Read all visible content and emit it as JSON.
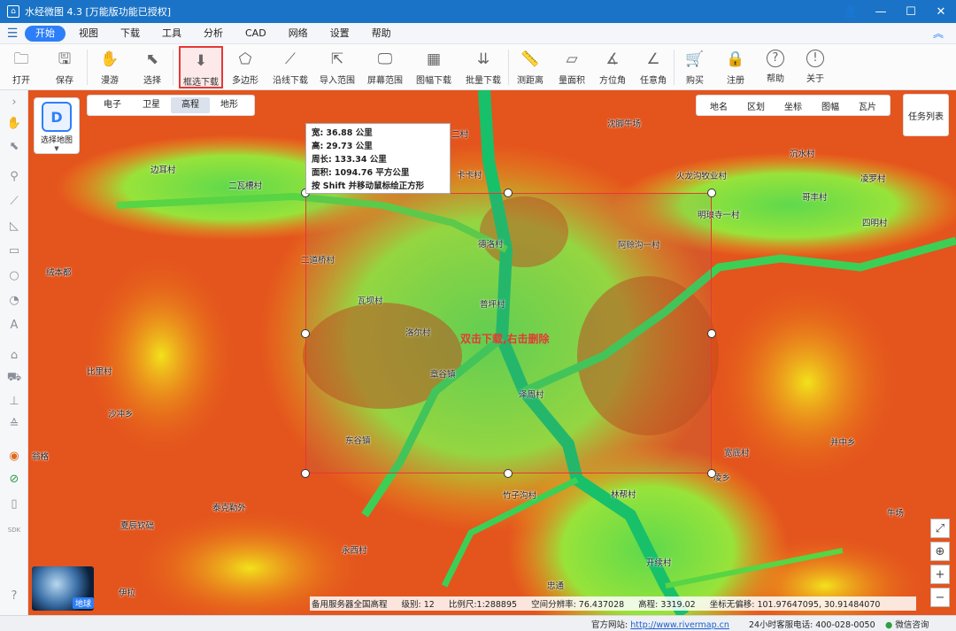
{
  "window": {
    "title": "水经微图 4.3 [万能版功能已授权]",
    "controls": [
      "👤",
      "—",
      "☐",
      "✕"
    ]
  },
  "menu": {
    "items": [
      "开始",
      "视图",
      "下载",
      "工具",
      "分析",
      "CAD",
      "网络",
      "设置",
      "帮助"
    ],
    "active": "开始"
  },
  "toolbar": {
    "tools": [
      {
        "label": "打开",
        "icon": "folder-icon",
        "glyph": "🗀"
      },
      {
        "label": "保存",
        "icon": "save-icon",
        "glyph": "🖫"
      },
      {
        "label": "漫游",
        "icon": "hand-icon",
        "glyph": "✋"
      },
      {
        "label": "选择",
        "icon": "cursor-icon",
        "glyph": "⬉"
      },
      {
        "label": "框选下载",
        "icon": "box-download-icon",
        "glyph": "⬇",
        "selected": true
      },
      {
        "label": "多边形",
        "icon": "polygon-icon",
        "glyph": "⬠"
      },
      {
        "label": "沿线下载",
        "icon": "polyline-icon",
        "glyph": "⟋"
      },
      {
        "label": "导入范围",
        "icon": "import-icon",
        "glyph": "⇱"
      },
      {
        "label": "屏幕范围",
        "icon": "screen-icon",
        "glyph": "🖵"
      },
      {
        "label": "图幅下载",
        "icon": "grid-icon",
        "glyph": "▦"
      },
      {
        "label": "批量下载",
        "icon": "batch-download-icon",
        "glyph": "⇊"
      },
      {
        "label": "测距离",
        "icon": "ruler-icon",
        "glyph": "📏"
      },
      {
        "label": "量面积",
        "icon": "area-icon",
        "glyph": "▱"
      },
      {
        "label": "方位角",
        "icon": "azimuth-icon",
        "glyph": "∡"
      },
      {
        "label": "任意角",
        "icon": "angle-icon",
        "glyph": "∠"
      },
      {
        "label": "购买",
        "icon": "cart-icon",
        "glyph": "🛒"
      },
      {
        "label": "注册",
        "icon": "register-icon",
        "glyph": "🔒"
      },
      {
        "label": "帮助",
        "icon": "help-icon",
        "glyph": "?"
      },
      {
        "label": "关于",
        "icon": "info-icon",
        "glyph": "!"
      }
    ]
  },
  "map_selector": {
    "label": "选择地图"
  },
  "layer_tabs": {
    "items": [
      "电子",
      "卫星",
      "高程",
      "地形"
    ],
    "active": "高程"
  },
  "overlay_tabs": {
    "items": [
      "地名",
      "区划",
      "坐标",
      "图幅",
      "瓦片"
    ]
  },
  "task_list": {
    "label": "任务列表"
  },
  "selection_info": {
    "width_label": "宽:",
    "width_value": "36.88 公里",
    "height_label": "高:",
    "height_value": "29.73 公里",
    "perimeter_label": "周长:",
    "perimeter_value": "133.34 公里",
    "area_label": "面积:",
    "area_value": "1094.76 平方公里",
    "hint": "按 Shift 并移动鼠标绘正方形"
  },
  "center_hint": "双击下载,右击删除",
  "places": [
    "沈脚牛场",
    "二村",
    "沉水村",
    "边耳村",
    "卡卡村",
    "火龙沟牧业村",
    "凌罗村",
    "二瓦槽村",
    "哥丰村",
    "明琅寺一村",
    "四明村",
    "德洛村",
    "阿赊沟一村",
    "二道桥村",
    "绒本都",
    "瓦坝村",
    "普坪村",
    "洛尔村",
    "比里村",
    "章谷镇",
    "泽周村",
    "沙冲乡",
    "东谷镇",
    "宽底村",
    "并中乡",
    "翁格",
    "凌乡",
    "竹子沟村",
    "林帮村",
    "泰克勒外",
    "夏辰钦础",
    "永西村",
    "开续村",
    "牛场",
    "伊拉",
    "忠通"
  ],
  "globe": {
    "label": "地球"
  },
  "status": {
    "server": "备用服务器全国高程",
    "level_label": "级别:",
    "level": "12",
    "scale_label": "比例尺:",
    "scale": "1:288895",
    "resolution_label": "空间分辨率:",
    "resolution": "76.437028",
    "elevation_label": "高程:",
    "elevation": "3319.02",
    "coord_label": "坐标无偏移:",
    "coord": "101.97647095, 30.91484070"
  },
  "footer": {
    "site_label": "官方网站:",
    "site_url": "http://www.rivermap.cn",
    "phone": "24小时客服电话: 400-028-0050",
    "consult": "微信咨询"
  }
}
